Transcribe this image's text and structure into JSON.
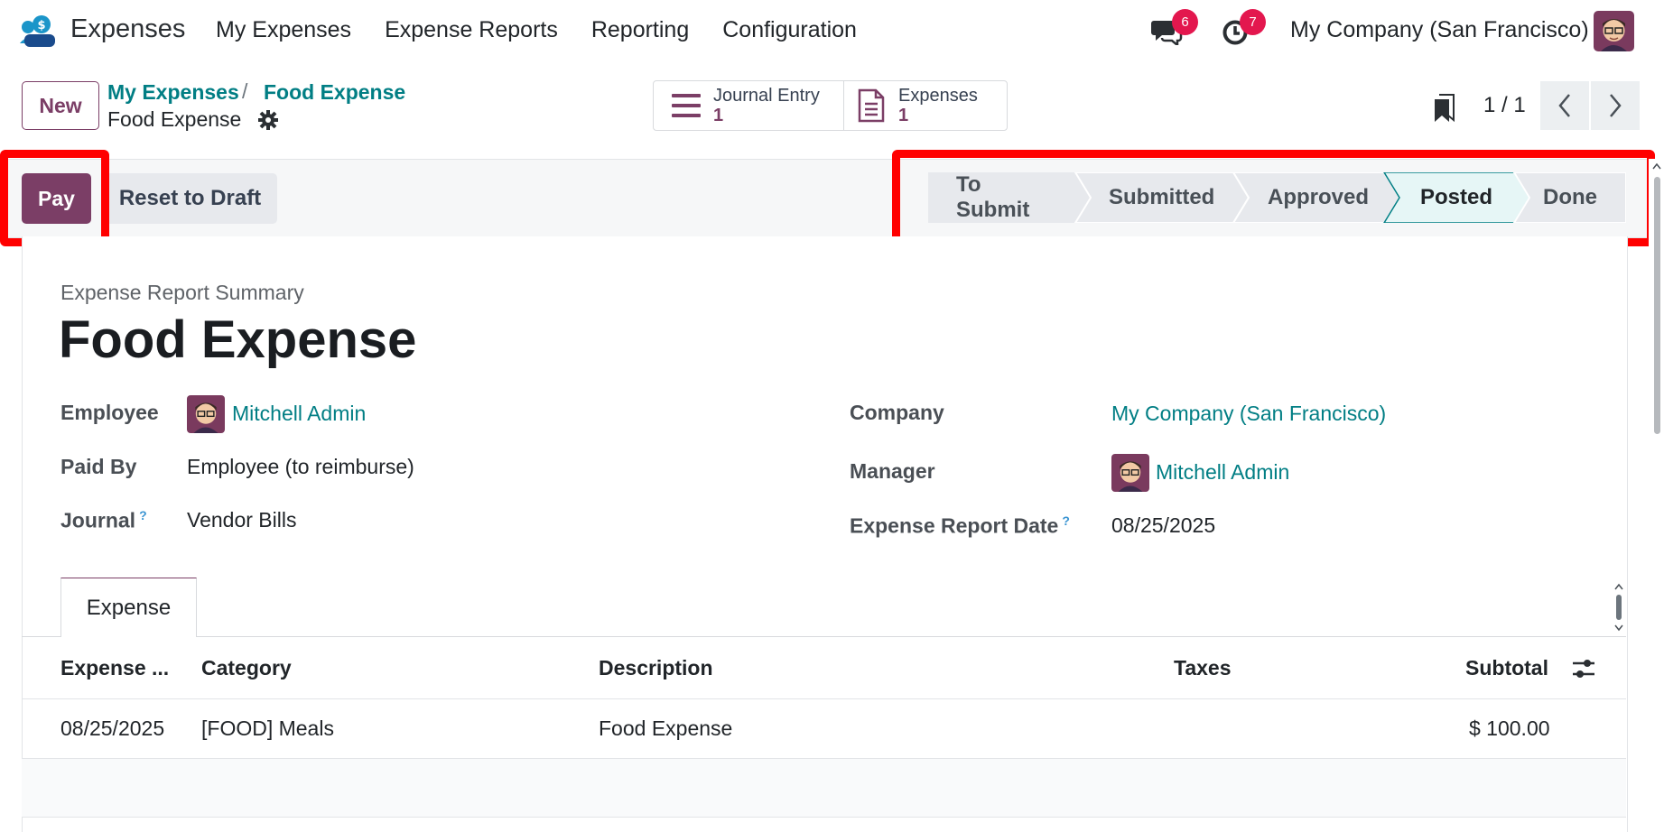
{
  "nav": {
    "app_name": "Expenses",
    "menu": [
      "My Expenses",
      "Expense Reports",
      "Reporting",
      "Configuration"
    ],
    "messages_badge": "6",
    "activities_badge": "7",
    "company": "My Company (San Francisco)"
  },
  "control": {
    "new_label": "New",
    "breadcrumb": [
      "My Expenses",
      "Food Expense"
    ],
    "breadcrumb_sep": "/",
    "current": "Food Expense",
    "smart_buttons": [
      {
        "label": "Journal Entry",
        "value": "1",
        "icon": "list-icon"
      },
      {
        "label": "Expenses",
        "value": "1",
        "icon": "document-icon"
      }
    ],
    "pager": "1 / 1"
  },
  "statusbar": {
    "pay_label": "Pay",
    "reset_label": "Reset to Draft",
    "stages": [
      "To Submit",
      "Submitted",
      "Approved",
      "Posted",
      "Done"
    ],
    "active_stage": "Posted"
  },
  "form": {
    "subtitle": "Expense Report Summary",
    "title": "Food Expense",
    "left": {
      "employee_label": "Employee",
      "employee_value": "Mitchell Admin",
      "paid_by_label": "Paid By",
      "paid_by_value": "Employee (to reimburse)",
      "journal_label": "Journal",
      "journal_value": "Vendor Bills"
    },
    "right": {
      "company_label": "Company",
      "company_value": "My Company (San Francisco)",
      "manager_label": "Manager",
      "manager_value": "Mitchell Admin",
      "date_label": "Expense Report Date",
      "date_value": "08/25/2025"
    },
    "help_mark": "?"
  },
  "notebook": {
    "tab": "Expense",
    "columns": [
      "Expense ...",
      "Category",
      "Description",
      "Taxes",
      "Subtotal"
    ],
    "rows": [
      {
        "date": "08/25/2025",
        "category": "[FOOD] Meals",
        "description": "Food Expense",
        "taxes": "",
        "subtotal": "$ 100.00"
      }
    ]
  },
  "colors": {
    "primary": "#7b3e66",
    "link": "#017e84",
    "badge": "#e3174e",
    "highlight": "#ff0000",
    "active_stage_bg": "#e6f6f6"
  }
}
